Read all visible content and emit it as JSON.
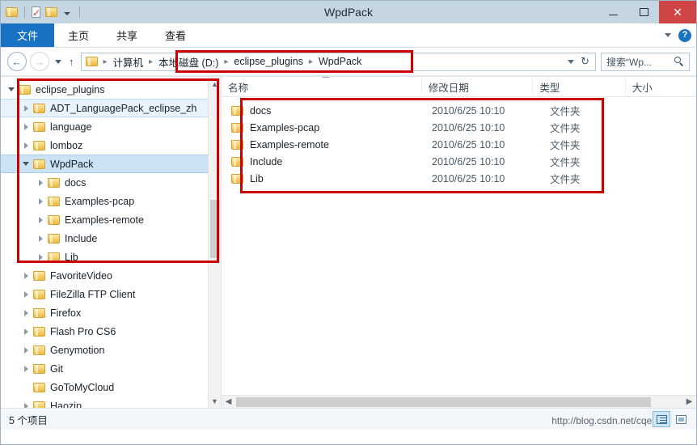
{
  "window": {
    "title": "WpdPack",
    "minimize_label": "–",
    "maximize_label": "",
    "close_label": "✕"
  },
  "quick_access": {
    "items": [
      {
        "name": "folder-icon",
        "label": ""
      },
      {
        "name": "properties-icon",
        "label": ""
      },
      {
        "name": "new-folder-icon",
        "label": ""
      },
      {
        "name": "customize-dropdown-icon",
        "label": ""
      }
    ]
  },
  "ribbon": {
    "tabs": [
      {
        "label": "文件",
        "active": true
      },
      {
        "label": "主页",
        "active": false
      },
      {
        "label": "共享",
        "active": false
      },
      {
        "label": "查看",
        "active": false
      }
    ],
    "expand_icon": "chevron-down-icon",
    "help_label": "?"
  },
  "address": {
    "back_label": "←",
    "forward_label": "→",
    "recent_icon": "chevron-down-icon",
    "up_label": "↑",
    "breadcrumbs": [
      "计算机",
      "本地磁盘 (D:)",
      "eclipse_plugins",
      "WpdPack"
    ],
    "separator": "▸",
    "dropdown_icon": "chevron-down-icon",
    "refresh_label": "↻",
    "search_placeholder": "搜索“Wp...",
    "search_value": "",
    "search_icon": "search-icon"
  },
  "sidebar": {
    "items": [
      {
        "label": "eclipse_plugins",
        "indent": 0,
        "expander": "down",
        "state": "normal"
      },
      {
        "label": "ADT_LanguagePack_eclipse_zh",
        "indent": 1,
        "expander": "right",
        "state": "hover"
      },
      {
        "label": "language",
        "indent": 1,
        "expander": "right",
        "state": "normal"
      },
      {
        "label": "lomboz",
        "indent": 1,
        "expander": "right",
        "state": "normal"
      },
      {
        "label": "WpdPack",
        "indent": 1,
        "expander": "down",
        "state": "selected"
      },
      {
        "label": "docs",
        "indent": 2,
        "expander": "right",
        "state": "normal"
      },
      {
        "label": "Examples-pcap",
        "indent": 2,
        "expander": "right",
        "state": "normal"
      },
      {
        "label": "Examples-remote",
        "indent": 2,
        "expander": "right",
        "state": "normal"
      },
      {
        "label": "Include",
        "indent": 2,
        "expander": "right",
        "state": "normal"
      },
      {
        "label": "Lib",
        "indent": 2,
        "expander": "right",
        "state": "normal"
      },
      {
        "label": "FavoriteVideo",
        "indent": 1,
        "expander": "right",
        "state": "normal"
      },
      {
        "label": "FileZilla FTP Client",
        "indent": 1,
        "expander": "right",
        "state": "normal"
      },
      {
        "label": "Firefox",
        "indent": 1,
        "expander": "right",
        "state": "normal"
      },
      {
        "label": "Flash Pro CS6",
        "indent": 1,
        "expander": "right",
        "state": "normal"
      },
      {
        "label": "Genymotion",
        "indent": 1,
        "expander": "right",
        "state": "normal"
      },
      {
        "label": "Git",
        "indent": 1,
        "expander": "right",
        "state": "normal"
      },
      {
        "label": "GoToMyCloud",
        "indent": 1,
        "expander": "none",
        "state": "normal"
      },
      {
        "label": "Haozip",
        "indent": 1,
        "expander": "right",
        "state": "normal"
      }
    ],
    "scroll_up_icon": "chevron-up-icon",
    "scroll_down_icon": "chevron-down-icon"
  },
  "filelist": {
    "columns": [
      {
        "label": "名称",
        "sorted": "asc"
      },
      {
        "label": "修改日期",
        "sorted": ""
      },
      {
        "label": "类型",
        "sorted": ""
      },
      {
        "label": "大小",
        "sorted": ""
      }
    ],
    "rows": [
      {
        "name": "docs",
        "date": "2010/6/25 10:10",
        "type": "文件夹",
        "size": ""
      },
      {
        "name": "Examples-pcap",
        "date": "2010/6/25 10:10",
        "type": "文件夹",
        "size": ""
      },
      {
        "name": "Examples-remote",
        "date": "2010/6/25 10:10",
        "type": "文件夹",
        "size": ""
      },
      {
        "name": "Include",
        "date": "2010/6/25 10:10",
        "type": "文件夹",
        "size": ""
      },
      {
        "name": "Lib",
        "date": "2010/6/25 10:10",
        "type": "文件夹",
        "size": ""
      }
    ],
    "scroll_left_icon": "chevron-left-icon",
    "scroll_right_icon": "chevron-right-icon"
  },
  "status": {
    "item_count_text": "5 个项目",
    "view_details_icon": "details-view-icon",
    "view_icons_icon": "large-icons-view-icon",
    "watermark": "http://blog.csdn.net/cqere"
  },
  "annotations": {
    "accent_red": "#cc0000",
    "boxes": [
      {
        "name": "breadcrumb-highlight"
      },
      {
        "name": "tree-highlight"
      },
      {
        "name": "filelist-highlight"
      }
    ]
  }
}
